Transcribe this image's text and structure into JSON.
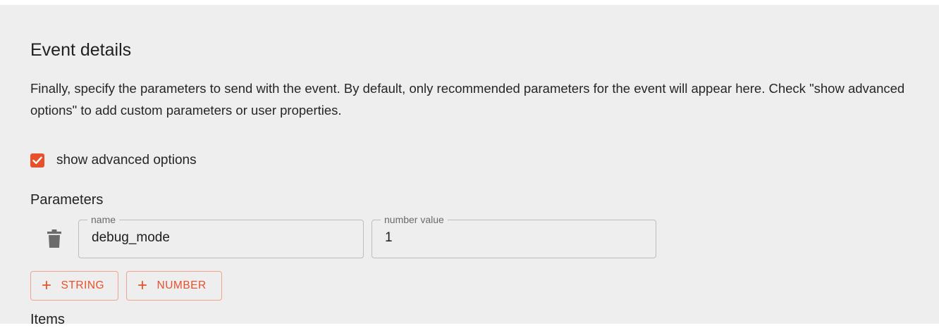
{
  "top_partial": {
    "text": "",
    "accent": "_"
  },
  "event_details": {
    "title": "Event details",
    "description": "Finally, specify the parameters to send with the event. By default, only recommended parameters for the event will appear here. Check \"show advanced options\" to add custom parameters or user properties."
  },
  "advanced_options": {
    "label": "show advanced options",
    "checked": true
  },
  "parameters": {
    "title": "Parameters",
    "rows": [
      {
        "name_legend": "name",
        "name_value": "debug_mode",
        "value_legend": "number value",
        "value": "1"
      }
    ],
    "buttons": {
      "add_string": "STRING",
      "add_number": "NUMBER"
    }
  },
  "items": {
    "title": "Items"
  },
  "colors": {
    "accent": "#e8502b",
    "panel_bg": "#eeeeee",
    "border": "#bdbdbd"
  },
  "icons": {
    "delete": "trash-icon",
    "checkbox": "check-icon",
    "add": "plus-icon"
  }
}
